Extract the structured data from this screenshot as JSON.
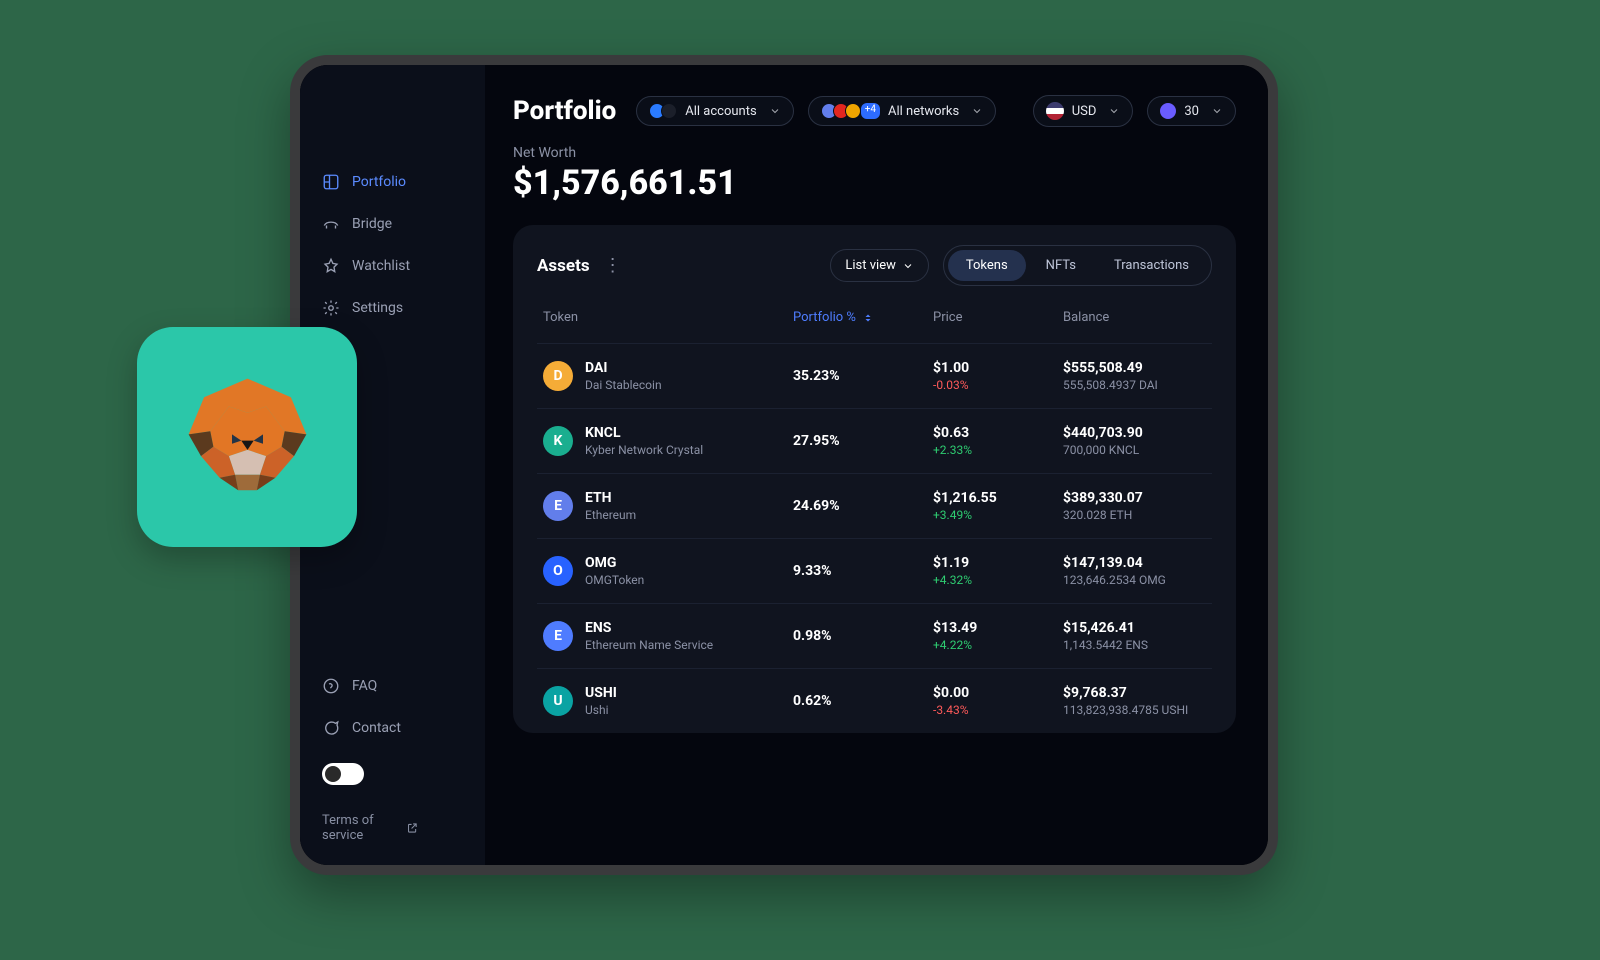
{
  "header": {
    "title": "Portfolio",
    "accounts_label": "All accounts",
    "networks_label": "All networks",
    "networks_extra": "+4",
    "currency": "USD",
    "gas": "30"
  },
  "sidebar": {
    "items": [
      {
        "label": "Portfolio"
      },
      {
        "label": "Bridge"
      },
      {
        "label": "Watchlist"
      },
      {
        "label": "Settings"
      }
    ],
    "bottom": [
      {
        "label": "FAQ"
      },
      {
        "label": "Contact"
      }
    ],
    "tos": "Terms of service"
  },
  "summary": {
    "networth_label": "Net Worth",
    "networth": "$1,576,661.51"
  },
  "panel": {
    "title": "Assets",
    "listview": "List view",
    "tabs": [
      "Tokens",
      "NFTs",
      "Transactions"
    ],
    "columns": {
      "token": "Token",
      "pct": "Portfolio %",
      "price": "Price",
      "balance": "Balance"
    }
  },
  "tokens": [
    {
      "sym": "DAI",
      "name": "Dai Stablecoin",
      "pct": "35.23%",
      "price": "$1.00",
      "change": "-0.03%",
      "dir": "neg",
      "bal": "$555,508.49",
      "balsub": "555,508.4937 DAI",
      "color": "#f5ac37"
    },
    {
      "sym": "KNCL",
      "name": "Kyber Network Crystal",
      "pct": "27.95%",
      "price": "$0.63",
      "change": "+2.33%",
      "dir": "pos",
      "bal": "$440,703.90",
      "balsub": "700,000 KNCL",
      "color": "#1aae8f"
    },
    {
      "sym": "ETH",
      "name": "Ethereum",
      "pct": "24.69%",
      "price": "$1,216.55",
      "change": "+3.49%",
      "dir": "pos",
      "bal": "$389,330.07",
      "balsub": "320.028 ETH",
      "color": "#627eeb"
    },
    {
      "sym": "OMG",
      "name": "OMGToken",
      "pct": "9.33%",
      "price": "$1.19",
      "change": "+4.32%",
      "dir": "pos",
      "bal": "$147,139.04",
      "balsub": "123,646.2534 OMG",
      "color": "#2862ff"
    },
    {
      "sym": "ENS",
      "name": "Ethereum Name Service",
      "pct": "0.98%",
      "price": "$13.49",
      "change": "+4.22%",
      "dir": "pos",
      "bal": "$15,426.41",
      "balsub": "1,143.5442 ENS",
      "color": "#4f7cff"
    },
    {
      "sym": "USHI",
      "name": "Ushi",
      "pct": "0.62%",
      "price": "$0.00",
      "change": "-3.43%",
      "dir": "neg",
      "bal": "$9,768.37",
      "balsub": "113,823,938.4785 USHI",
      "color": "#0aa3a3"
    }
  ]
}
